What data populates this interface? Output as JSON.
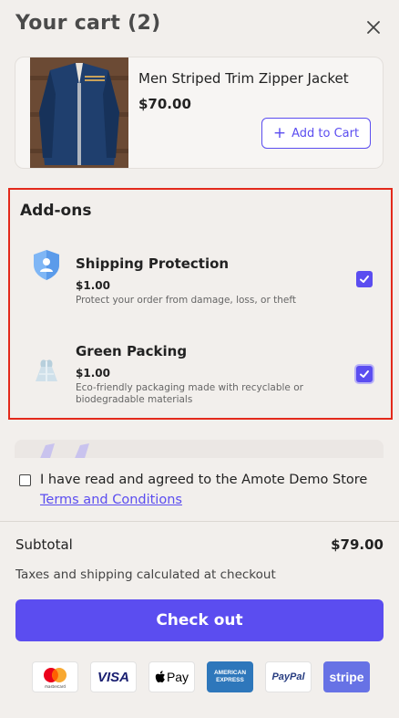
{
  "header": {
    "title": "Your cart (2)",
    "close_icon": "close-icon"
  },
  "cart_item": {
    "name": "Men Striped Trim Zipper Jacket",
    "price": "$70.00",
    "add_label": "Add to Cart",
    "add_icon": "plus-icon"
  },
  "addons": {
    "title": "Add-ons",
    "items": [
      {
        "name": "Shipping Protection",
        "price": "$1.00",
        "description": "Protect your order from damage, loss, or theft",
        "icon": "shield-icon",
        "checked": true
      },
      {
        "name": "Green Packing",
        "price": "$1.00",
        "description": "Eco-friendly packaging made with recyclable or biodegradable materials",
        "icon": "eco-bag-icon",
        "checked": true
      }
    ]
  },
  "footer": {
    "terms_text": "I have read and agreed to the Amote Demo Store ",
    "terms_link": "Terms and Conditions",
    "subtotal_label": "Subtotal",
    "subtotal_value": "$79.00",
    "tax_note": "Taxes and shipping calculated at checkout",
    "checkout_label": "Check out",
    "payment_methods": [
      "mastercard",
      "VISA",
      "Pay",
      "AMERICAN EXPRESS",
      "PayPal",
      "stripe"
    ]
  },
  "colors": {
    "accent": "#5b4df0",
    "highlight_border": "#e3291b",
    "background": "#f2efec"
  }
}
